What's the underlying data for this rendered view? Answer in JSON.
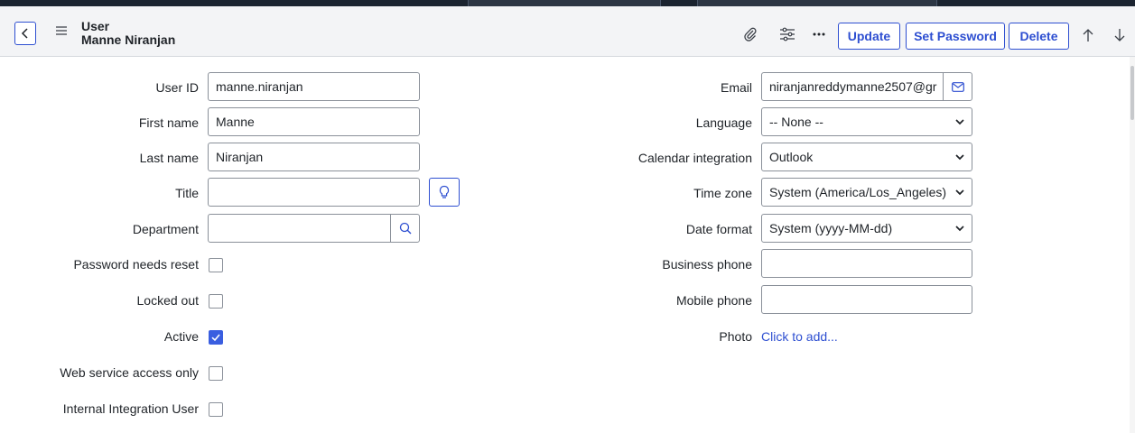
{
  "header": {
    "record_type": "User",
    "record_name": "Manne Niranjan",
    "buttons": {
      "update": "Update",
      "set_password": "Set Password",
      "delete": "Delete"
    },
    "icons": [
      "chevron-left-icon",
      "hamburger-menu-icon",
      "paperclip-icon",
      "settings-sliders-icon",
      "more-options-icon",
      "arrow-up-icon",
      "arrow-down-icon"
    ]
  },
  "left_fields": {
    "user_id": {
      "label": "User ID",
      "value": "manne.niranjan"
    },
    "first_name": {
      "label": "First name",
      "value": "Manne"
    },
    "last_name": {
      "label": "Last name",
      "value": "Niranjan"
    },
    "title": {
      "label": "Title",
      "value": ""
    },
    "department": {
      "label": "Department",
      "value": ""
    }
  },
  "checkboxes": {
    "password_needs_reset": {
      "label": "Password needs reset",
      "checked": false
    },
    "locked_out": {
      "label": "Locked out",
      "checked": false
    },
    "active": {
      "label": "Active",
      "checked": true
    },
    "web_service_access_only": {
      "label": "Web service access only",
      "checked": false
    },
    "internal_integration_user": {
      "label": "Internal Integration User",
      "checked": false
    }
  },
  "right_fields": {
    "email": {
      "label": "Email",
      "value": "niranjanreddymanne2507@gr"
    },
    "language": {
      "label": "Language",
      "value": "-- None --"
    },
    "calendar_integration": {
      "label": "Calendar integration",
      "value": "Outlook"
    },
    "time_zone": {
      "label": "Time zone",
      "value": "System (America/Los_Angeles)"
    },
    "date_format": {
      "label": "Date format",
      "value": "System (yyyy-MM-dd)"
    },
    "business_phone": {
      "label": "Business phone",
      "value": ""
    },
    "mobile_phone": {
      "label": "Mobile phone",
      "value": ""
    },
    "photo": {
      "label": "Photo",
      "link": "Click to add..."
    }
  },
  "colors": {
    "accent": "#2e4fd1",
    "header_bg": "#f3f4f6",
    "checkbox_checked": "#3a5ee0"
  }
}
